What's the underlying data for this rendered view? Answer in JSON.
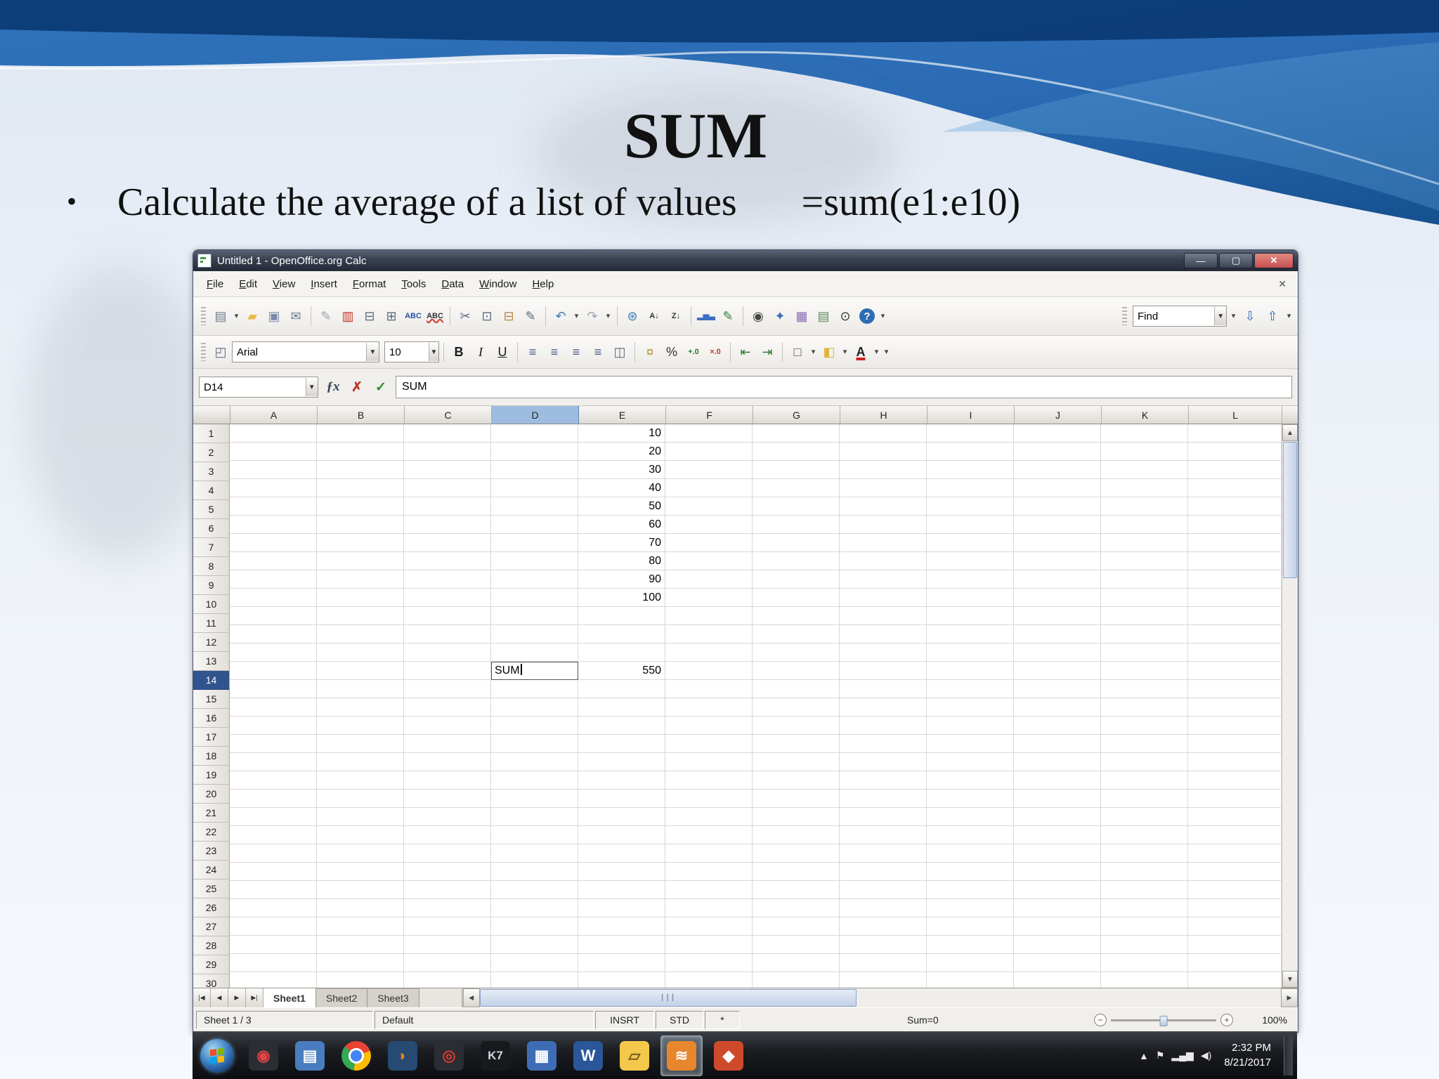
{
  "slide": {
    "title": "SUM",
    "bullet_text": "Calculate the average of a list of values",
    "bullet_formula": "=sum(e1:e10)"
  },
  "colors": {
    "selected_column_header": "#9dbce0",
    "selected_row_header": "#31548f",
    "close_button_red": "#c75050",
    "accent_blue": "#2b6cb5"
  },
  "window": {
    "title": "Untitled 1 - OpenOffice.org Calc",
    "menus": [
      "File",
      "Edit",
      "View",
      "Insert",
      "Format",
      "Tools",
      "Data",
      "Window",
      "Help"
    ],
    "controls": [
      {
        "name": "minimize-button",
        "glyph": "—"
      },
      {
        "name": "maximize-button",
        "glyph": "▢"
      },
      {
        "name": "close-button",
        "glyph": "✕",
        "close": true
      }
    ]
  },
  "std_toolbar": {
    "icons": [
      {
        "name": "new-document-icon",
        "glyph": "▤",
        "color": "#6e7b8c",
        "dropdown": true
      },
      {
        "name": "open-icon",
        "glyph": "▰",
        "color": "#edba4e"
      },
      {
        "name": "save-icon",
        "glyph": "▣",
        "color": "#7a8aa8"
      },
      {
        "name": "email-icon",
        "glyph": "✉",
        "color": "#6e7b8c"
      },
      {
        "sep": true
      },
      {
        "name": "edit-file-icon",
        "glyph": "✎",
        "color": "#9aa4b0"
      },
      {
        "name": "export-pdf-icon",
        "glyph": "▥",
        "color": "#c0392b"
      },
      {
        "name": "print-icon",
        "glyph": "⊟",
        "color": "#5a6a7e"
      },
      {
        "name": "page-preview-icon",
        "glyph": "⊞",
        "color": "#5a6a7e"
      },
      {
        "name": "spellcheck-icon",
        "glyph": "ABC",
        "color": "#2a50a0",
        "small": true
      },
      {
        "name": "autospellcheck-icon",
        "glyph": "ABC",
        "color": "#333333",
        "small": true,
        "wavy": true
      },
      {
        "sep": true
      },
      {
        "name": "cut-icon",
        "glyph": "✂",
        "color": "#5a6a7e"
      },
      {
        "name": "copy-icon",
        "glyph": "⊡",
        "color": "#5a6a7e"
      },
      {
        "name": "paste-icon",
        "glyph": "⊟",
        "color": "#b08a4a"
      },
      {
        "name": "format-paintbrush-icon",
        "glyph": "✎",
        "color": "#5a6a7e"
      },
      {
        "sep": true
      },
      {
        "name": "undo-icon",
        "glyph": "↶",
        "color": "#3f7fae",
        "dropdown": true
      },
      {
        "name": "redo-icon",
        "glyph": "↷",
        "color": "#9aa4b0",
        "dropdown": true
      },
      {
        "sep": true
      },
      {
        "name": "hyperlink-icon",
        "glyph": "⊛",
        "color": "#3f7fae"
      },
      {
        "name": "sort-ascending-icon",
        "glyph": "A↓",
        "color": "#333333",
        "small": true
      },
      {
        "name": "sort-descending-icon",
        "glyph": "Z↓",
        "color": "#333333",
        "small": true
      },
      {
        "sep": true
      },
      {
        "name": "chart-icon",
        "glyph": "▂▅▃",
        "color": "#3a6ebf",
        "small": true
      },
      {
        "name": "draw-functions-icon",
        "glyph": "✎",
        "color": "#2e7d32"
      },
      {
        "sep": true
      },
      {
        "name": "find-replace-icon",
        "glyph": "◉",
        "color": "#444444"
      },
      {
        "name": "navigator-icon",
        "glyph": "✦",
        "color": "#3a6ebf"
      },
      {
        "name": "gallery-icon",
        "glyph": "▦",
        "color": "#8a6ab0"
      },
      {
        "name": "datasources-icon",
        "glyph": "▤",
        "color": "#5a8a5a"
      },
      {
        "name": "zoom-icon",
        "glyph": "⊙",
        "color": "#333333"
      },
      {
        "name": "help-icon",
        "glyph": "?",
        "cls": "i-help"
      },
      {
        "name": "toolbar-options-icon",
        "glyph": "▾",
        "narrow": true
      }
    ],
    "find_value": "Find",
    "find_icons": [
      {
        "name": "find-dropdown-arrow",
        "glyph": "▾",
        "narrow": true
      },
      {
        "name": "find-next-icon",
        "glyph": "⇩",
        "color": "#2b6cb5"
      },
      {
        "name": "find-previous-icon",
        "glyph": "⇧",
        "color": "#2b6cb5"
      },
      {
        "name": "find-options-icon",
        "glyph": "▾",
        "narrow": true
      }
    ]
  },
  "formatting": {
    "styles_icon": "◰",
    "font_name": "Arial",
    "font_size": "10",
    "icons": [
      {
        "sep": true
      },
      {
        "name": "bold-icon",
        "glyph": "B",
        "cls": "i-b",
        "color": "#1a1a1a"
      },
      {
        "name": "italic-icon",
        "glyph": "I",
        "cls": "i-i",
        "color": "#1a1a1a"
      },
      {
        "name": "underline-icon",
        "glyph": "U",
        "cls": "i-u",
        "color": "#1a1a1a"
      },
      {
        "sep": true
      },
      {
        "name": "align-left-icon",
        "glyph": "≡",
        "color": "#44588a"
      },
      {
        "name": "align-center-icon",
        "glyph": "≡",
        "color": "#44588a"
      },
      {
        "name": "align-right-icon",
        "glyph": "≡",
        "color": "#44588a"
      },
      {
        "name": "align-justify-icon",
        "glyph": "≡",
        "color": "#44588a"
      },
      {
        "name": "merge-cells-icon",
        "glyph": "◫",
        "color": "#5a6a7e"
      },
      {
        "sep": true
      },
      {
        "name": "currency-format-icon",
        "glyph": "¤",
        "color": "#b8912f"
      },
      {
        "name": "percent-format-icon",
        "glyph": "%",
        "color": "#333333"
      },
      {
        "name": "add-decimal-icon",
        "glyph": "+.0",
        "color": "#2e7d32",
        "small": true
      },
      {
        "name": "delete-decimal-icon",
        "glyph": "×.0",
        "color": "#c0392b",
        "small": true
      },
      {
        "sep": true
      },
      {
        "name": "decrease-indent-icon",
        "glyph": "⇤",
        "color": "#2e7d32"
      },
      {
        "name": "increase-indent-icon",
        "glyph": "⇥",
        "color": "#2e7d32"
      },
      {
        "sep": true
      },
      {
        "name": "borders-icon",
        "glyph": "□",
        "color": "#444444",
        "dropdown": true
      },
      {
        "name": "background-color-icon",
        "glyph": "◧",
        "color": "#e0b63a",
        "dropdown": true
      },
      {
        "name": "font-color-icon",
        "glyph": "A",
        "cls": "i-fontcolor",
        "color": "#222222",
        "dropdown": true
      },
      {
        "name": "formatting-options-icon",
        "glyph": "▾",
        "narrow": true
      }
    ]
  },
  "formula_bar": {
    "cell_reference": "D14",
    "input_value": "SUM",
    "icons": [
      {
        "name": "function-wizard-icon",
        "glyph": "ƒx",
        "color": "#33445a"
      },
      {
        "name": "cancel-icon",
        "glyph": "✗",
        "color": "#c0392b"
      },
      {
        "name": "accept-icon",
        "glyph": "✓",
        "color": "#2e8b2e"
      }
    ]
  },
  "grid": {
    "columns": [
      "A",
      "B",
      "C",
      "D",
      "E",
      "F",
      "G",
      "H",
      "I",
      "J",
      "K",
      "L"
    ],
    "row_count": 31,
    "selected_column": "D",
    "selected_row": 14,
    "cells": [
      {
        "col": "E",
        "row": 1,
        "value": "10",
        "align": "right"
      },
      {
        "col": "E",
        "row": 2,
        "value": "20",
        "align": "right"
      },
      {
        "col": "E",
        "row": 3,
        "value": "30",
        "align": "right"
      },
      {
        "col": "E",
        "row": 4,
        "value": "40",
        "align": "right"
      },
      {
        "col": "E",
        "row": 5,
        "value": "50",
        "align": "right"
      },
      {
        "col": "E",
        "row": 6,
        "value": "60",
        "align": "right"
      },
      {
        "col": "E",
        "row": 7,
        "value": "70",
        "align": "right"
      },
      {
        "col": "E",
        "row": 8,
        "value": "80",
        "align": "right"
      },
      {
        "col": "E",
        "row": 9,
        "value": "90",
        "align": "right"
      },
      {
        "col": "E",
        "row": 10,
        "value": "100",
        "align": "right"
      },
      {
        "col": "D",
        "row": 14,
        "value": "SUM",
        "align": "left",
        "editing": true
      },
      {
        "col": "E",
        "row": 14,
        "value": "550",
        "align": "right"
      }
    ]
  },
  "sheet_tabs": {
    "nav": [
      {
        "name": "first-sheet-button",
        "glyph": "|◀"
      },
      {
        "name": "previous-sheet-button",
        "glyph": "◀"
      },
      {
        "name": "next-sheet-button",
        "glyph": "▶"
      },
      {
        "name": "last-sheet-button",
        "glyph": "▶|"
      }
    ],
    "tabs": [
      "Sheet1",
      "Sheet2",
      "Sheet3"
    ],
    "active": "Sheet1"
  },
  "status_bar": {
    "sheet_info": "Sheet 1 / 3",
    "page_style": "Default",
    "insert_mode": "INSRT",
    "selection_mode": "STD",
    "modified_flag": "*",
    "sum_display": "Sum=0",
    "zoom_level": "100%"
  },
  "taskbar": {
    "time": "2:32 PM",
    "date": "8/21/2017",
    "apps": [
      {
        "name": "start-button",
        "type": "orb"
      },
      {
        "name": "media-player-icon",
        "glyph": "◉",
        "color": "#e04545",
        "bg": "#2a2d33"
      },
      {
        "name": "notes-app-icon",
        "glyph": "▤",
        "color": "#ffffff",
        "bg": "#4a7dbf"
      },
      {
        "name": "chrome-icon",
        "type": "chrome"
      },
      {
        "name": "firefox-icon",
        "glyph": "◗",
        "color": "#f0820f",
        "bg": "#274a73"
      },
      {
        "name": "nero-icon",
        "glyph": "◎",
        "color": "#d23b2e",
        "bg": "#2a2d33"
      },
      {
        "name": "k7-antivirus-icon",
        "glyph": "K7",
        "color": "#cdd6e4",
        "bg": "#17191d"
      },
      {
        "name": "calculator-icon",
        "glyph": "▦",
        "color": "#ffffff",
        "bg": "#3f6db5"
      },
      {
        "name": "word-icon",
        "glyph": "W",
        "color": "#ffffff",
        "bg": "#2b579a"
      },
      {
        "name": "explorer-icon",
        "glyph": "▱",
        "color": "#7a5a1e",
        "bg": "#f3c84b"
      },
      {
        "name": "openoffice-calc-icon",
        "glyph": "≋",
        "color": "#ffffff",
        "bg": "#e8862c",
        "active": true
      },
      {
        "name": "impress-icon",
        "glyph": "◆",
        "color": "#ffffff",
        "bg": "#cf4a2a"
      }
    ],
    "tray": [
      {
        "name": "hidden-icons-arrow",
        "glyph": "▲"
      },
      {
        "name": "action-center-icon",
        "glyph": "⚑"
      },
      {
        "name": "network-icon",
        "glyph": "▂▄▆"
      },
      {
        "name": "volume-icon",
        "glyph": "◀)"
      }
    ]
  }
}
